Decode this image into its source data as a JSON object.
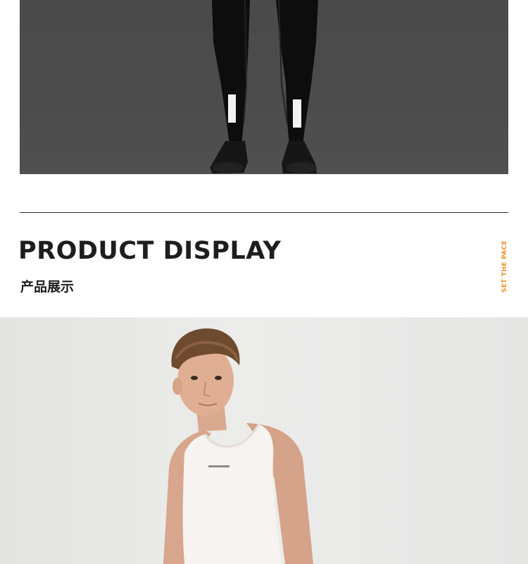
{
  "top_photo": {
    "alt": "black cycling leg warmers with reflective patches"
  },
  "section": {
    "title": "PRODUCT DISPLAY",
    "subtitle": "产品展示",
    "brand_tag": "SET THE PACE"
  },
  "model_photo": {
    "alt": "model wearing white sleeveless base layer"
  }
}
